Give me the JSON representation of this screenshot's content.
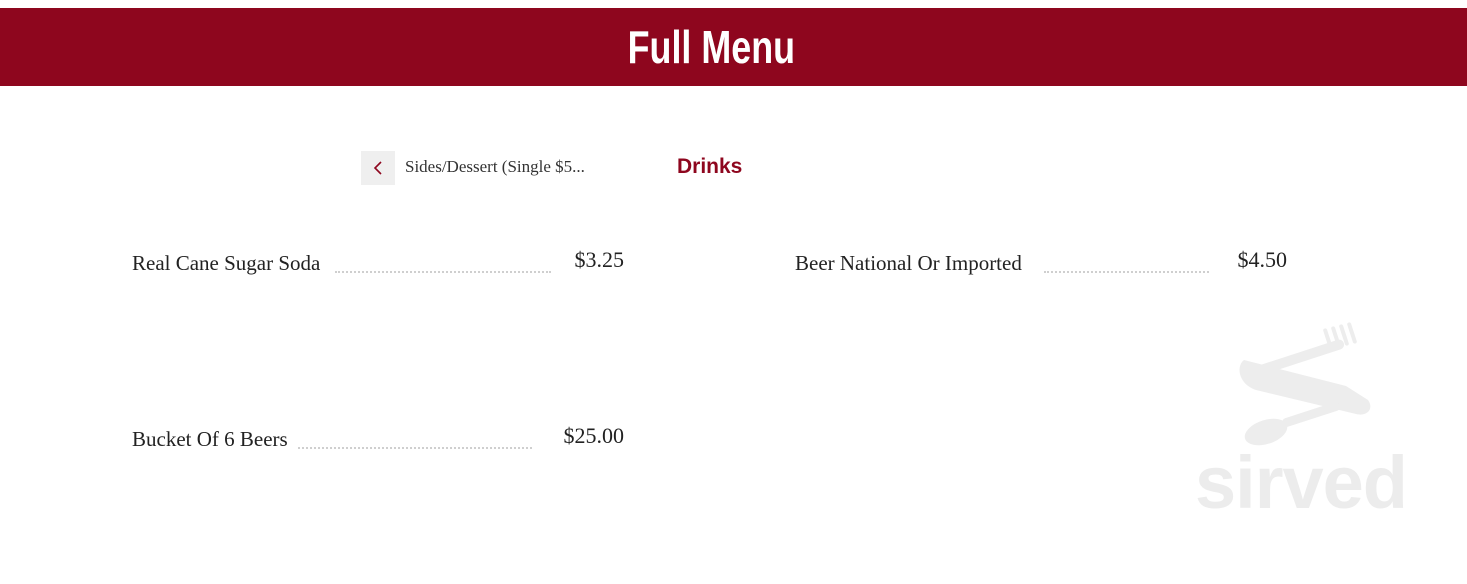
{
  "header": {
    "title": "Full Menu"
  },
  "category_nav": {
    "prev_icon": "chevron-left-icon",
    "prev_label": "Sides/Dessert (Single $5...",
    "active_label": "Drinks"
  },
  "items": [
    {
      "name": "Real Cane Sugar Soda",
      "price": "$3.25"
    },
    {
      "name": "Beer National Or Imported",
      "price": "$4.50"
    },
    {
      "name": "Bucket Of 6 Beers",
      "price": "$25.00"
    }
  ],
  "watermark": {
    "icon": "utensils-icon",
    "text": "sirved"
  },
  "colors": {
    "brand": "#8e061e",
    "watermark": "#ececec"
  }
}
